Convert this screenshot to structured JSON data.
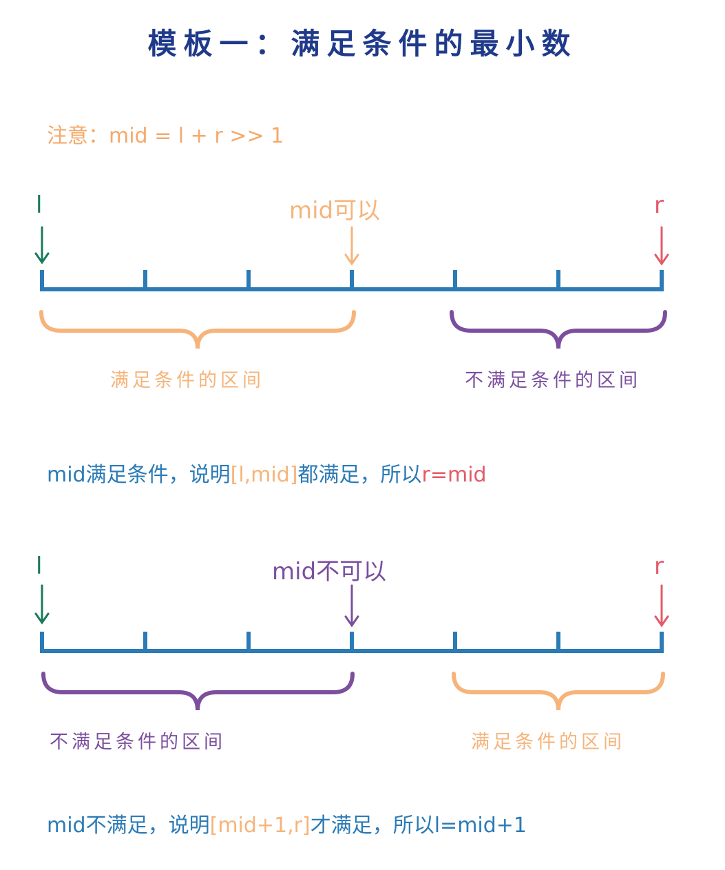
{
  "title": "模板一：满足条件的最小数",
  "note": "注意：mid = l + r >> 1",
  "colors": {
    "blue": "#2b7bb6",
    "orange": "#f6b47b",
    "purple": "#7b4f9e",
    "green": "#1a7a5a",
    "red": "#e35a68",
    "title": "#1f3a8a"
  },
  "section1": {
    "left_label": "l",
    "mid_label": "mid可以",
    "right_label": "r",
    "left_caption": "满足条件的区间",
    "right_caption": "不满足条件的区间",
    "statement": {
      "p1": "mid满足条件，说明",
      "p2": "[l,mid]",
      "p3": "都满足，所以",
      "p4": "r=mid"
    }
  },
  "section2": {
    "left_label": "l",
    "mid_label": "mid不可以",
    "right_label": "r",
    "left_caption": "不满足条件的区间",
    "right_caption": "满足条件的区间",
    "statement": {
      "p1": "mid不满足，说明",
      "p2": "[mid+1,r]",
      "p3": "才满足，所以",
      "p4": "l=mid+1"
    }
  }
}
